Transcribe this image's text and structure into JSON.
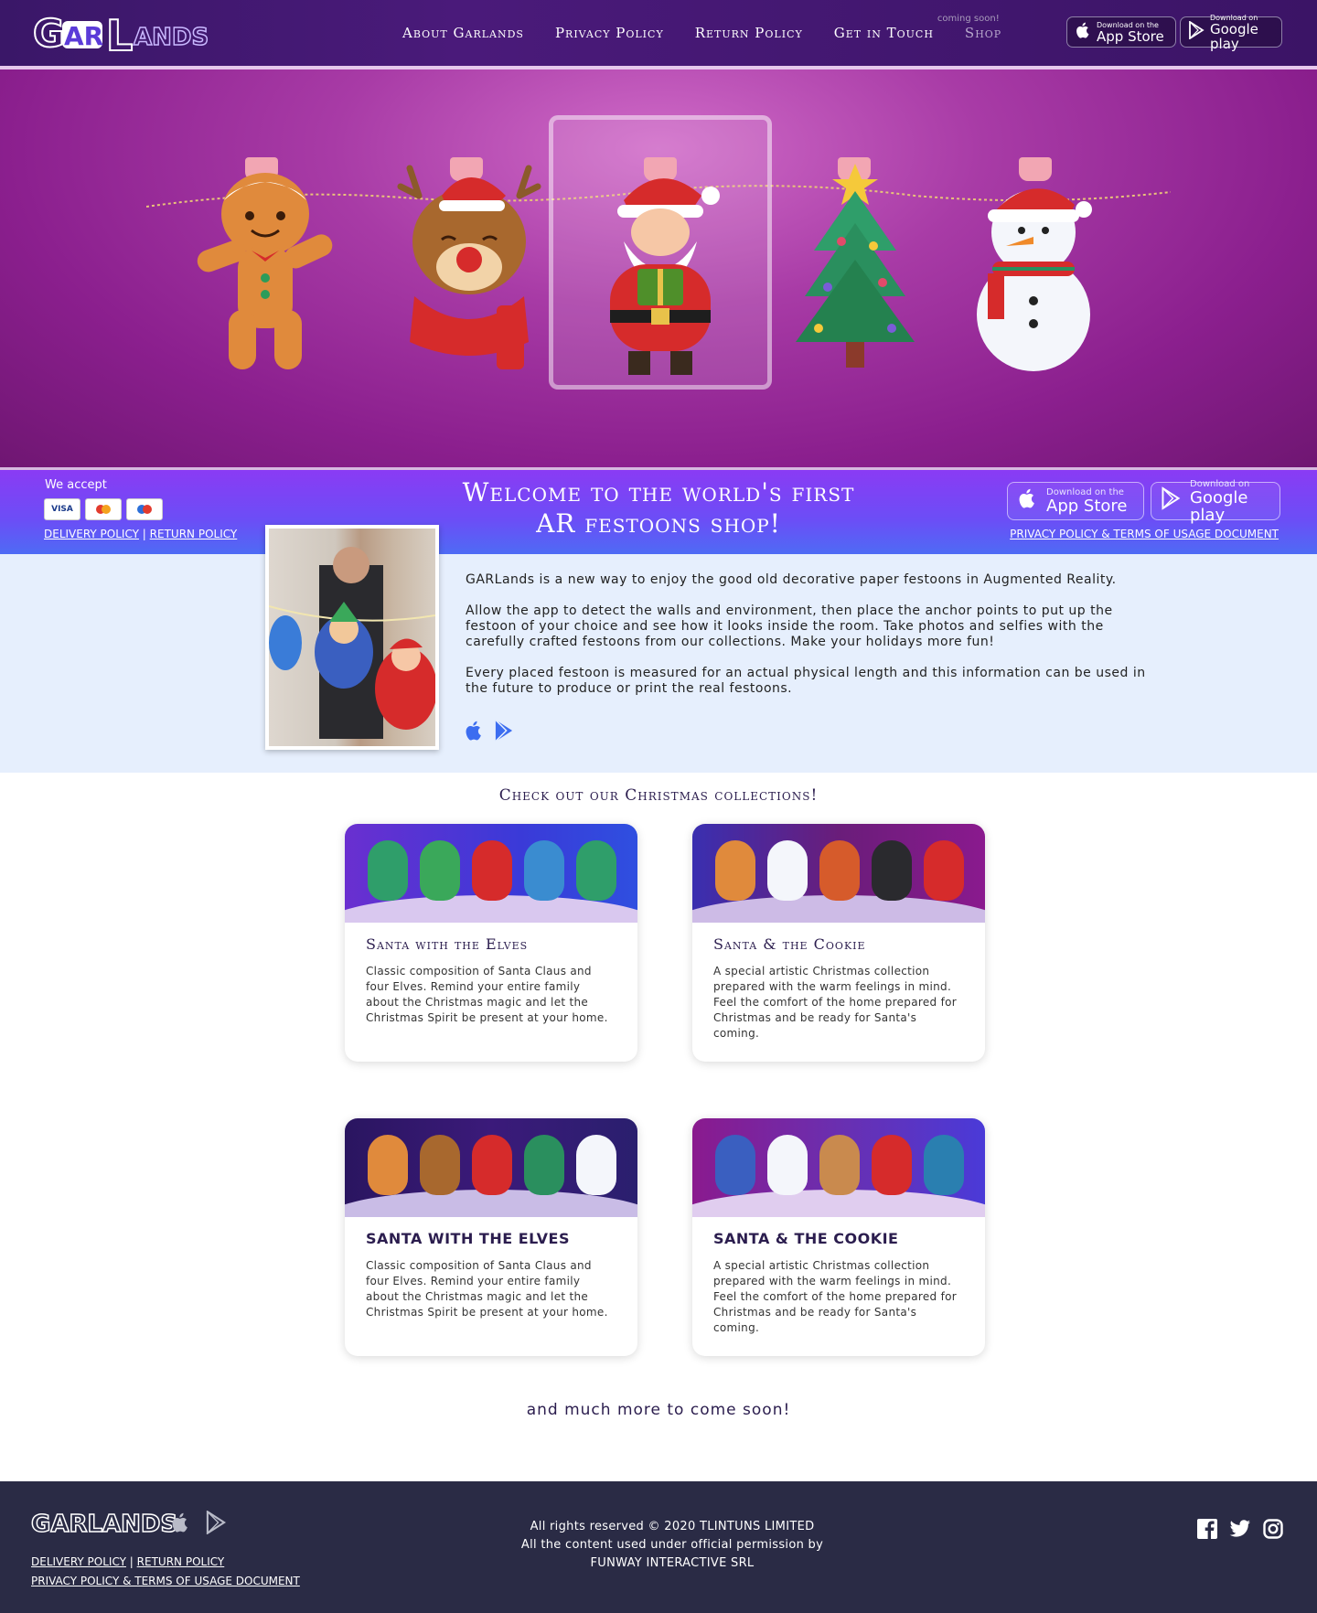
{
  "header": {
    "logo": "GARLANDS",
    "nav": [
      "About Garlands",
      "Privacy Policy",
      "Return Policy",
      "Get in Touch"
    ],
    "shop": "Shop",
    "coming_soon": "coming soon!",
    "app_store": {
      "sub": "Download on the",
      "main": "App Store"
    },
    "google_play": {
      "sub": "Download on",
      "main": "Google play"
    }
  },
  "hero": {
    "characters": [
      "gingerbread-man",
      "reindeer",
      "santa",
      "christmas-tree",
      "snowman"
    ]
  },
  "band": {
    "we_accept": "We accept",
    "cards": [
      "VISA",
      "Mastercard",
      "Maestro"
    ],
    "delivery_policy": "DELIVERY POLICY",
    "return_policy": "RETURN POLICY",
    "separator": "|",
    "welcome_line1": "Welcome to the world's first",
    "welcome_line2": "AR festoons shop!",
    "app_store": {
      "sub": "Download on the",
      "main": "App Store"
    },
    "google_play": {
      "sub": "Download on",
      "main": "Google play"
    },
    "privacy_terms": "PRIVACY POLICY & TERMS OF USAGE DOCUMENT"
  },
  "intro": {
    "p1": "GARLands is a new way to enjoy the good old decorative paper festoons in Augmented Reality.",
    "p2": "Allow the app to detect the walls and environment, then place the anchor points to put up the festoon of your choice and see how it looks inside the room. Take photos and selfies with the carefully crafted festoons from our collections. Make your holidays more fun!",
    "p3": "Every placed festoon is measured for an actual physical length and this information can be used in the future to produce or print the real festoons."
  },
  "collections": {
    "title": "Check out our Christmas collections!",
    "items": [
      {
        "title": "Santa with the Elves",
        "desc": "Classic composition of Santa Claus and four Elves. Remind your entire family about the Christmas magic and let the Christmas Spirit be present at your home."
      },
      {
        "title": "Santa & the Cookie",
        "desc": "A special artistic Christmas collection prepared with the warm feelings in mind. Feel the comfort of the home prepared for Christmas and be ready for Santa's coming."
      },
      {
        "title": "SANTA WITH THE ELVES",
        "desc": "Classic composition of Santa Claus and four Elves. Remind your entire family about the Christmas magic and let the Christmas Spirit be present at your home."
      },
      {
        "title": "SANTA & THE COOKIE",
        "desc": "A special artistic Christmas collection prepared with the warm feelings in mind. Feel the comfort of the home prepared for Christmas and be ready for Santa's coming."
      }
    ]
  },
  "more": "and much more to come soon!",
  "footer": {
    "logo": "GARLANDS",
    "delivery_policy": "DELIVERY POLICY",
    "return_policy": "RETURN POLICY",
    "separator": "|",
    "privacy_terms": "PRIVACY POLICY & TERMS OF USAGE DOCUMENT",
    "rights": "All rights reserved © 2020 TLINTUNS LIMITED",
    "permission": "All the content used under official permission by",
    "company": "FUNWAY INTERACTIVE SRL",
    "social": [
      "facebook-icon",
      "twitter-icon",
      "instagram-icon"
    ]
  }
}
